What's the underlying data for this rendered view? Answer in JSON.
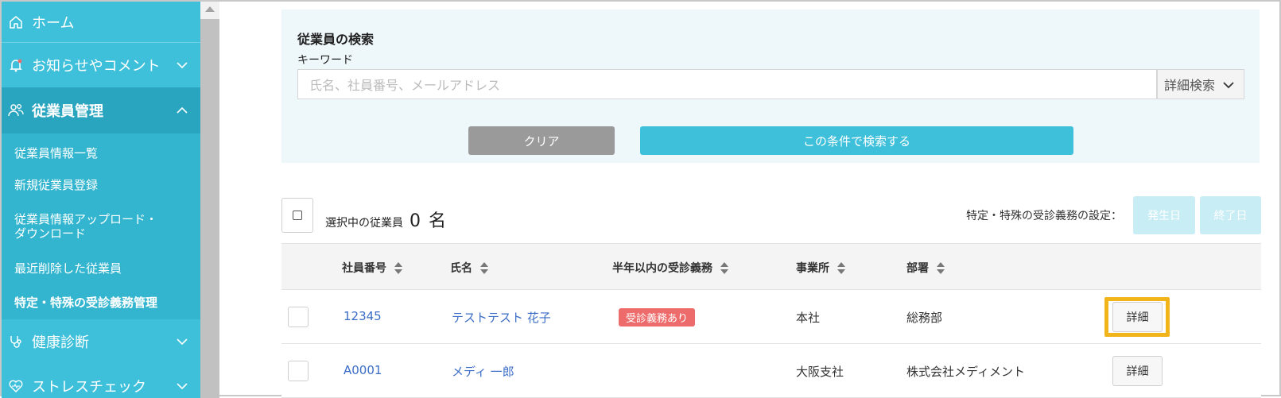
{
  "sidebar": {
    "home": {
      "label": "ホーム",
      "icon": "home-icon"
    },
    "sections": [
      {
        "label": "お知らせやコメント",
        "icon": "bell-icon"
      },
      {
        "label": "従業員管理",
        "icon": "users-icon"
      },
      {
        "label": "健康診断",
        "icon": "stethoscope-icon"
      },
      {
        "label": "ストレスチェック",
        "icon": "heart-icon"
      }
    ],
    "sub_items": [
      {
        "label": "従業員情報一覧"
      },
      {
        "label": "新規従業員登録"
      },
      {
        "label": "従業員情報アップロード・ダウンロード"
      },
      {
        "label": "最近削除した従業員"
      },
      {
        "label": "特定・特殊の受診義務管理"
      }
    ]
  },
  "search": {
    "title": "従業員の検索",
    "keyword_label": "キーワード",
    "placeholder": "氏名、社員番号、メールアドレス",
    "detail_search": "詳細検索",
    "clear_button": "クリア",
    "search_button": "この条件で検索する"
  },
  "selection": {
    "label": "選択中の従業員",
    "count": "0",
    "unit": "名",
    "setting_label": "特定・特殊の受診義務の設定：",
    "start_button": "発生日",
    "end_button": "終了日"
  },
  "table": {
    "headers": [
      "社員番号",
      "氏名",
      "半年以内の受診義務",
      "事業所",
      "部署"
    ],
    "rows": [
      {
        "id": "12345",
        "name": "テストテスト 花子",
        "badge": "受診義務あり",
        "office": "本社",
        "department": "総務部",
        "action": "詳細"
      },
      {
        "id": "A0001",
        "name": "メディ 一郎",
        "badge": "",
        "office": "大阪支社",
        "department": "株式会社メディメント",
        "action": "詳細"
      }
    ]
  },
  "colors": {
    "accent": "#3ec0da",
    "sidebar_active": "#2aa5bf",
    "badge": "#ee6b6b",
    "highlight": "#f1b41a",
    "link": "#3b6dc7"
  }
}
